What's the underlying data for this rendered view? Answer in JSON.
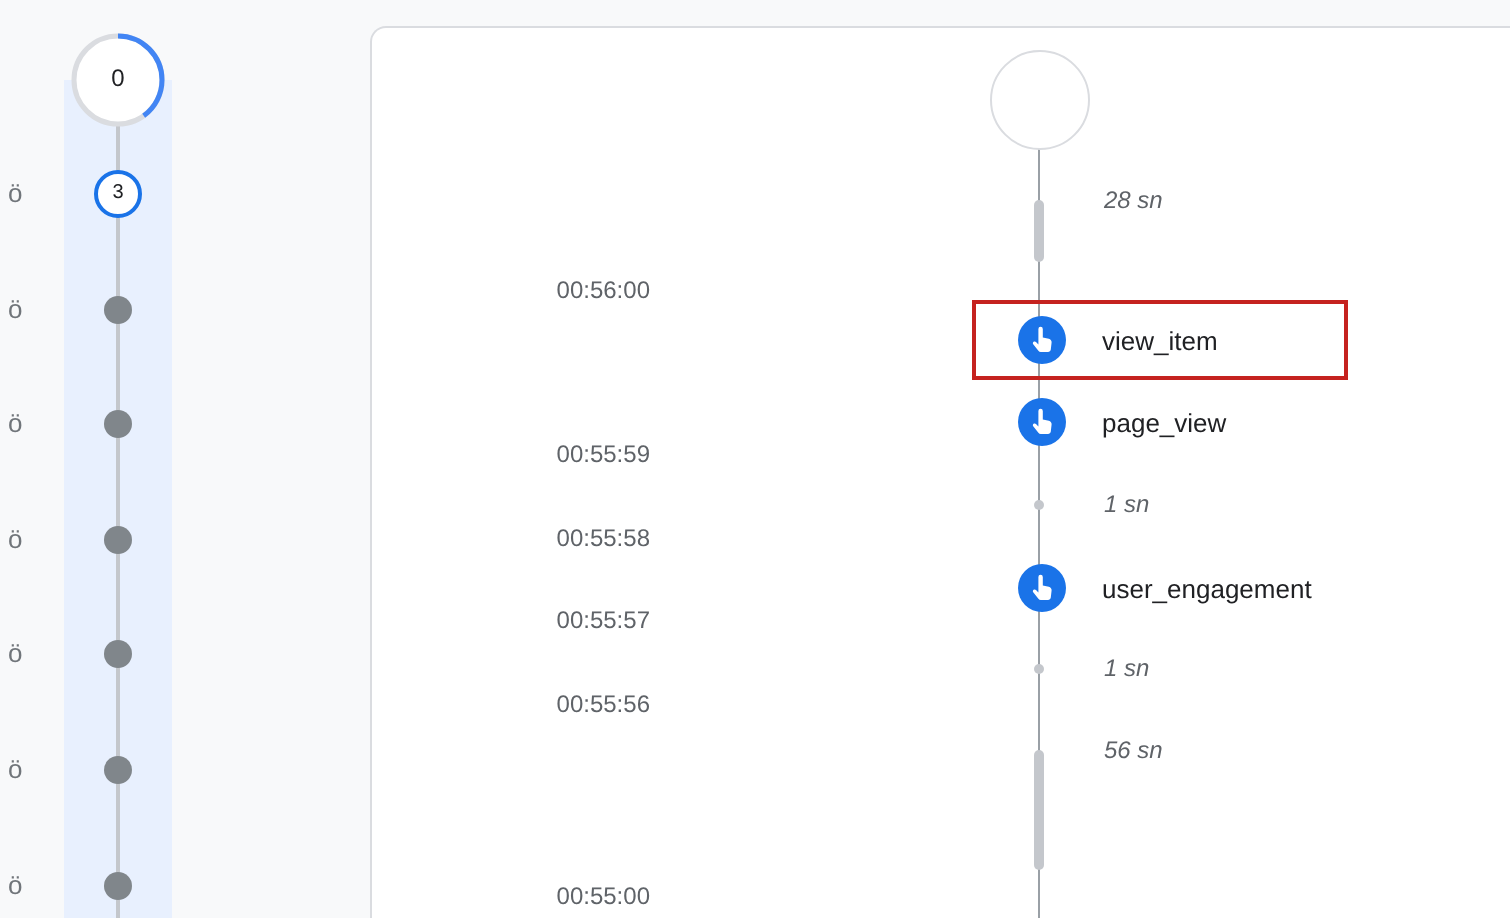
{
  "sidebar": {
    "session_ring": {
      "label": "0"
    },
    "rows": [
      {
        "time": "ö",
        "kind": "count",
        "count": "3"
      },
      {
        "time": "ö",
        "kind": "dot"
      },
      {
        "time": "ö",
        "kind": "dot"
      },
      {
        "time": "ö",
        "kind": "dot"
      },
      {
        "time": "ö",
        "kind": "dot"
      },
      {
        "time": "ö",
        "kind": "dot"
      },
      {
        "time": "ö",
        "kind": "dot"
      }
    ]
  },
  "timeline": {
    "items": [
      {
        "kind": "gap",
        "duration": "28 sn",
        "long_bar": true
      },
      {
        "kind": "time",
        "time": "00:56:00"
      },
      {
        "kind": "event",
        "name": "view_item",
        "highlighted": true
      },
      {
        "kind": "event",
        "name": "page_view",
        "highlighted": false
      },
      {
        "kind": "time",
        "time": "00:55:59"
      },
      {
        "kind": "gap",
        "duration": "1 sn",
        "long_bar": false
      },
      {
        "kind": "time",
        "time": "00:55:58"
      },
      {
        "kind": "event",
        "name": "user_engagement",
        "highlighted": false
      },
      {
        "kind": "time",
        "time": "00:55:57"
      },
      {
        "kind": "gap",
        "duration": "1 sn",
        "long_bar": false
      },
      {
        "kind": "time",
        "time": "00:55:56"
      },
      {
        "kind": "gap",
        "duration": "56 sn",
        "long_bar": true
      },
      {
        "kind": "time",
        "time": "00:55:00"
      }
    ]
  }
}
